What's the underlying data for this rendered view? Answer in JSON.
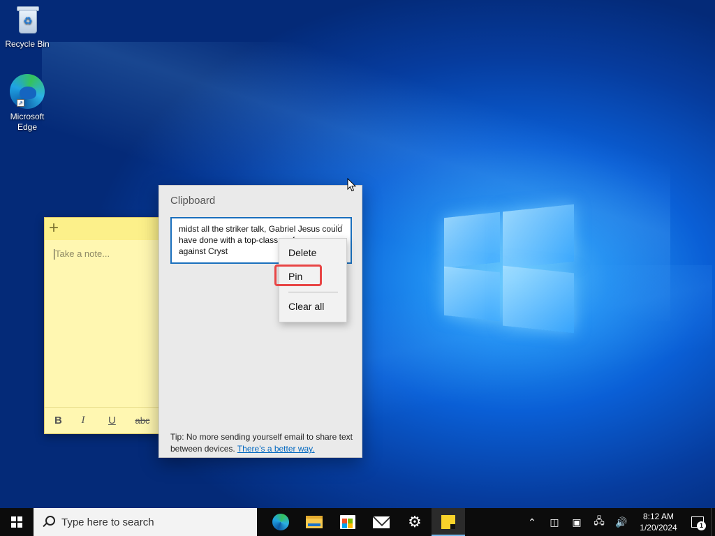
{
  "desktop": {
    "icons": [
      {
        "label": "Recycle Bin",
        "icon": "recycle-bin-icon"
      },
      {
        "label": "Microsoft Edge",
        "icon": "edge-icon"
      }
    ]
  },
  "sticky_note": {
    "placeholder": "Take a note...",
    "add_icon": "+",
    "toolbar": {
      "bold": "B",
      "italic": "I",
      "underline": "U",
      "strikethrough": "abc"
    }
  },
  "clipboard": {
    "title": "Clipboard",
    "item_text": "midst all the striker talk, Gabriel Jesus could have done with a top-class performance against Cryst",
    "more_label": "···",
    "tip_text": "Tip: No more sending yourself email to share text between devices. ",
    "tip_link": "There's a better way."
  },
  "context_menu": {
    "delete": "Delete",
    "pin": "Pin",
    "clear_all": "Clear all"
  },
  "taskbar": {
    "search_placeholder": "Type here to search",
    "clock_time": "8:12 AM",
    "clock_date": "1/20/2024",
    "notification_count": "1",
    "apps": [
      "edge-icon",
      "file-explorer-icon",
      "store-icon",
      "mail-icon",
      "settings-icon",
      "sticky-notes-icon"
    ]
  },
  "colors": {
    "accent": "#1a6fbd",
    "highlight": "#e84545",
    "sticky_yellow": "#fff7b1"
  }
}
